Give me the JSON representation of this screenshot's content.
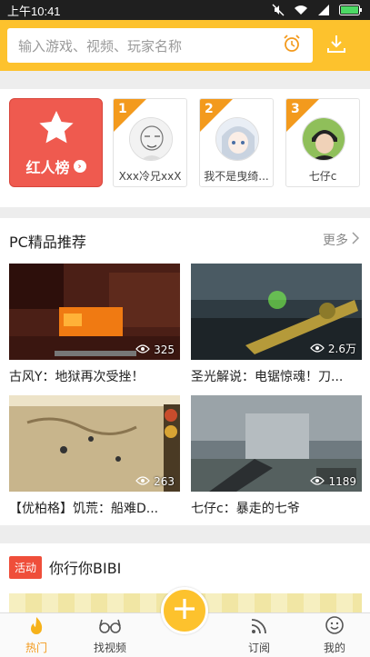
{
  "status_bar": {
    "time": "上午10:41"
  },
  "header": {
    "search_placeholder": "输入游戏、视频、玩家名称"
  },
  "ranking": {
    "board_label": "红人榜",
    "items": [
      {
        "rank": "1",
        "name": "Xxx冷兄xxX"
      },
      {
        "rank": "2",
        "name": "我不是曳绮..."
      },
      {
        "rank": "3",
        "name": "七仔c"
      }
    ]
  },
  "section": {
    "title": "PC精品推荐",
    "more_label": "更多",
    "videos": [
      {
        "title": "古风Y：地狱再次受挫！",
        "views": "325"
      },
      {
        "title": "圣光解说：电锯惊魂！刀...",
        "views": "2.6万"
      },
      {
        "title": "【优柏格】饥荒：船难D...",
        "views": "263"
      },
      {
        "title": "七仔c：暴走的七爷",
        "views": "1189"
      }
    ]
  },
  "activity": {
    "badge": "活动",
    "title": "你行你BIBI"
  },
  "bottom_nav": {
    "tabs": [
      {
        "label": "热门",
        "icon": "flame-icon"
      },
      {
        "label": "找视频",
        "icon": "glasses-icon"
      },
      {
        "label": "订阅",
        "icon": "rss-icon"
      },
      {
        "label": "我的",
        "icon": "smiley-icon"
      }
    ]
  },
  "colors": {
    "accent": "#fdc22d",
    "active_tab": "#f39a1d",
    "red_board": "#ef5a4f",
    "badge": "#ef4e3a"
  }
}
